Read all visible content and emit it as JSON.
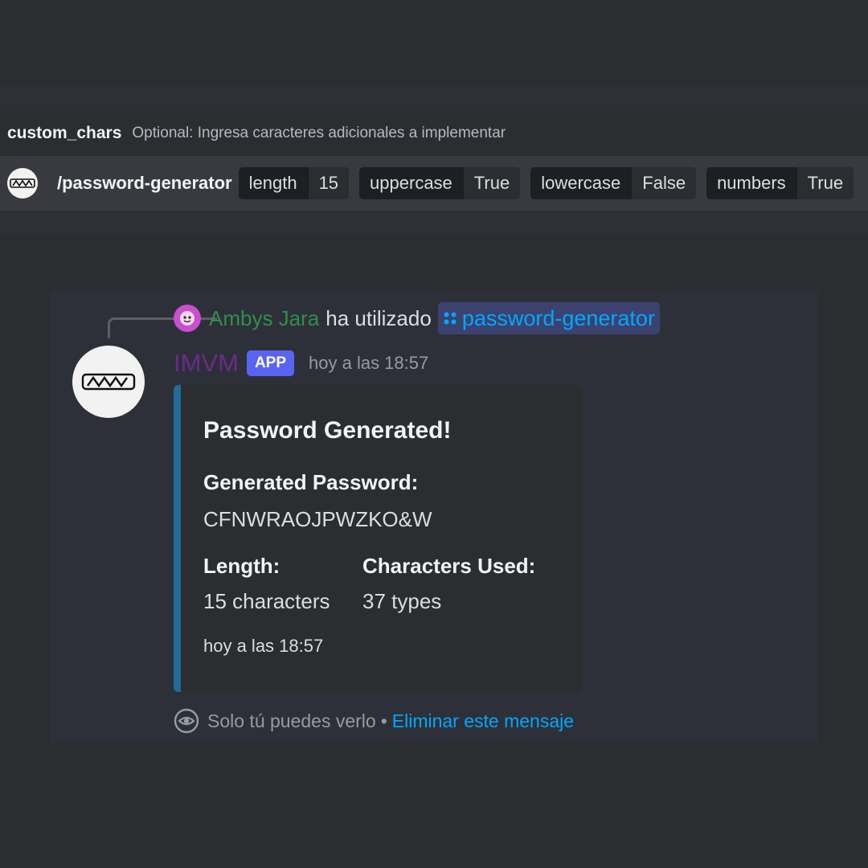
{
  "option_hint": {
    "name": "custom_chars",
    "description": "Optional: Ingresa caracteres adicionales a implementar"
  },
  "command_bar": {
    "command": "/password-generator",
    "options": [
      {
        "key": "length",
        "value": "15"
      },
      {
        "key": "uppercase",
        "value": "True"
      },
      {
        "key": "lowercase",
        "value": "False"
      },
      {
        "key": "numbers",
        "value": "True"
      }
    ]
  },
  "message": {
    "reply": {
      "user": "Ambys Jara",
      "text": "ha utilizado",
      "command": "password-generator"
    },
    "author": "IMVM",
    "badge": "APP",
    "timestamp": "hoy a las 18:57",
    "embed": {
      "color": "#1f6b9b",
      "title": "Password Generated!",
      "field_password_name": "Generated Password:",
      "field_password_value": "CFNWRAOJPWZKO&W",
      "field_length_name": "Length:",
      "field_length_value": "15 characters",
      "field_chars_name": "Characters Used:",
      "field_chars_value": "37 types",
      "footer": "hoy a las 18:57"
    },
    "ephemeral": {
      "text": "Solo tú puedes verlo",
      "separator": "•",
      "link": "Eliminar este mensaje"
    }
  },
  "colors": {
    "background": "#2b2d31",
    "link": "#00a8fc",
    "app_badge": "#5865f2",
    "reply_user": "#2f8e4c",
    "author": "#6a2b8a"
  }
}
